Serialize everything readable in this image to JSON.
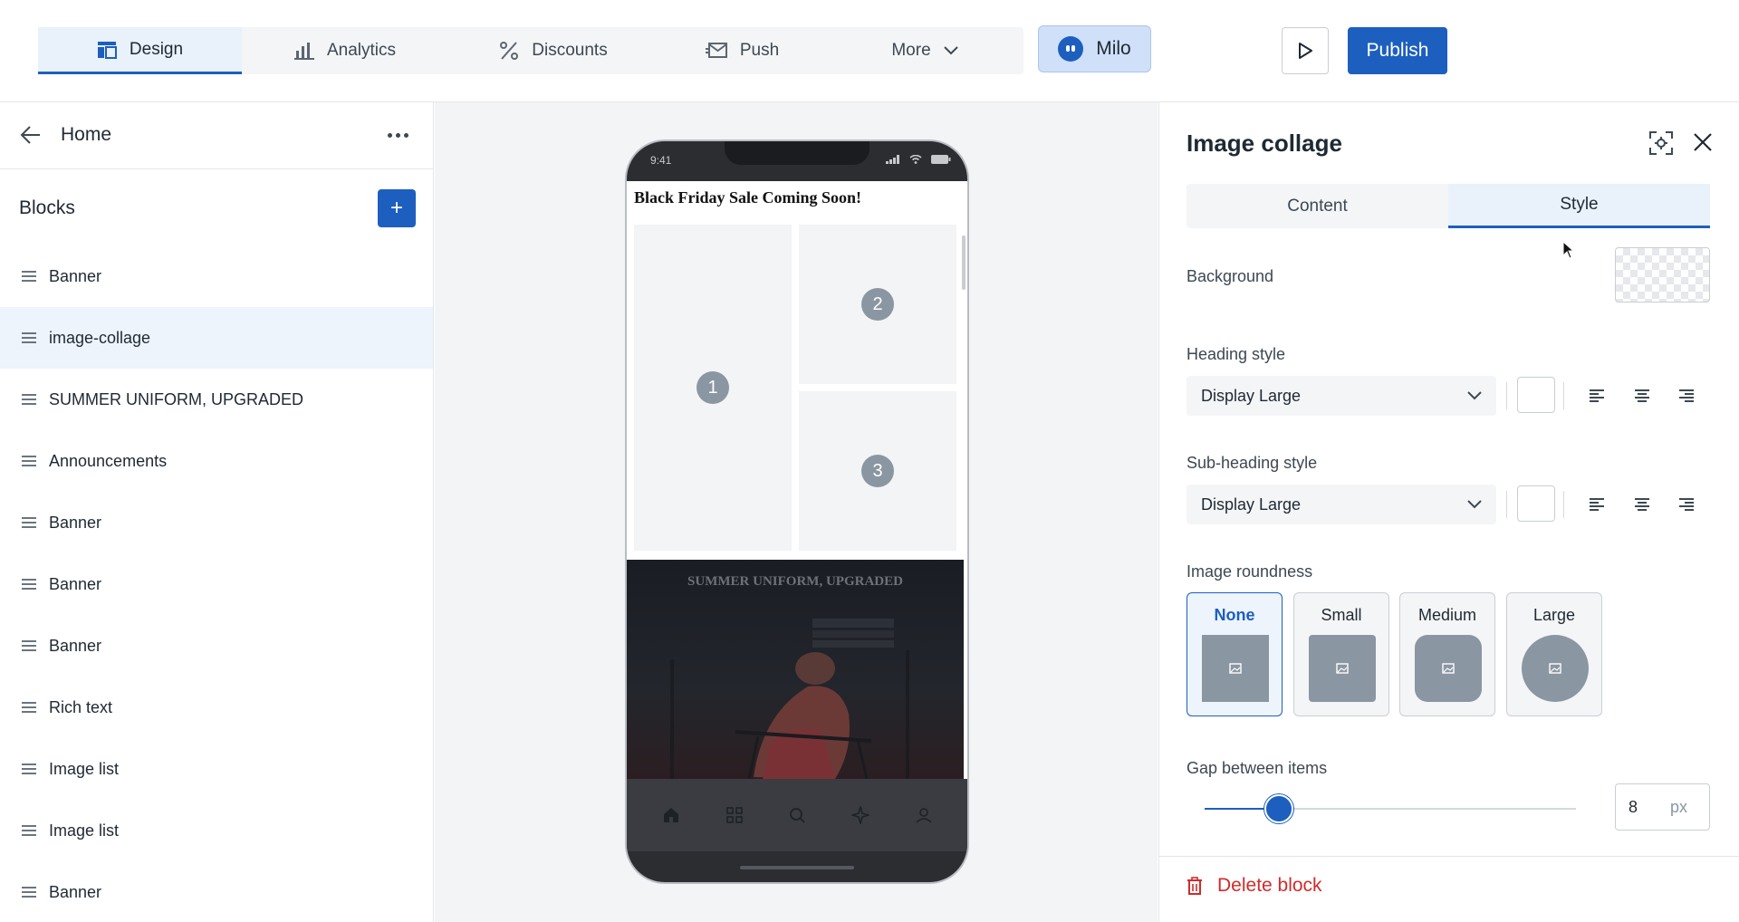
{
  "nav": {
    "tabs": [
      {
        "label": "Design",
        "icon": "layout-icon",
        "active": true
      },
      {
        "label": "Analytics",
        "icon": "bar-chart-icon",
        "active": false
      },
      {
        "label": "Discounts",
        "icon": "percent-icon",
        "active": false
      },
      {
        "label": "Push",
        "icon": "send-mail-icon",
        "active": false
      },
      {
        "label": "More",
        "icon": "chevron-down-icon",
        "active": false
      }
    ],
    "milo_label": "Milo",
    "publish_label": "Publish"
  },
  "sidebar": {
    "title": "Home",
    "blocks_title": "Blocks",
    "add_label": "+",
    "items": [
      {
        "label": "Banner"
      },
      {
        "label": "image-collage",
        "active": true
      },
      {
        "label": "SUMMER UNIFORM, UPGRADED"
      },
      {
        "label": "Announcements"
      },
      {
        "label": "Banner"
      },
      {
        "label": "Banner"
      },
      {
        "label": "Banner"
      },
      {
        "label": "Rich text"
      },
      {
        "label": "Image list"
      },
      {
        "label": "Image list"
      },
      {
        "label": "Banner"
      }
    ]
  },
  "phone": {
    "time": "9:41",
    "sale_title": "Black Friday Sale Coming Soon!",
    "tiles": [
      "1",
      "2",
      "3"
    ],
    "banner_title": "SUMMER UNIFORM, UPGRADED",
    "bottom_nav": [
      "home-icon",
      "grid-icon",
      "search-icon",
      "sparkle-icon",
      "profile-icon"
    ]
  },
  "panel": {
    "title": "Image collage",
    "tabs": [
      {
        "label": "Content",
        "active": false
      },
      {
        "label": "Style",
        "active": true
      }
    ],
    "background_label": "Background",
    "heading_style_label": "Heading style",
    "heading_style_value": "Display Large",
    "subheading_style_label": "Sub-heading style",
    "subheading_style_value": "Display Large",
    "roundness_label": "Image roundness",
    "roundness_options": [
      {
        "label": "None",
        "active": true
      },
      {
        "label": "Small",
        "active": false
      },
      {
        "label": "Medium",
        "active": false
      },
      {
        "label": "Large",
        "active": false
      }
    ],
    "gap_label": "Gap between items",
    "gap_value": "8",
    "gap_unit": "px",
    "gap_slider_fraction": 0.2,
    "delete_label": "Delete block"
  },
  "colors": {
    "accent": "#1d5fbf",
    "danger": "#d12b2b",
    "active_bg": "#eef4fc"
  }
}
